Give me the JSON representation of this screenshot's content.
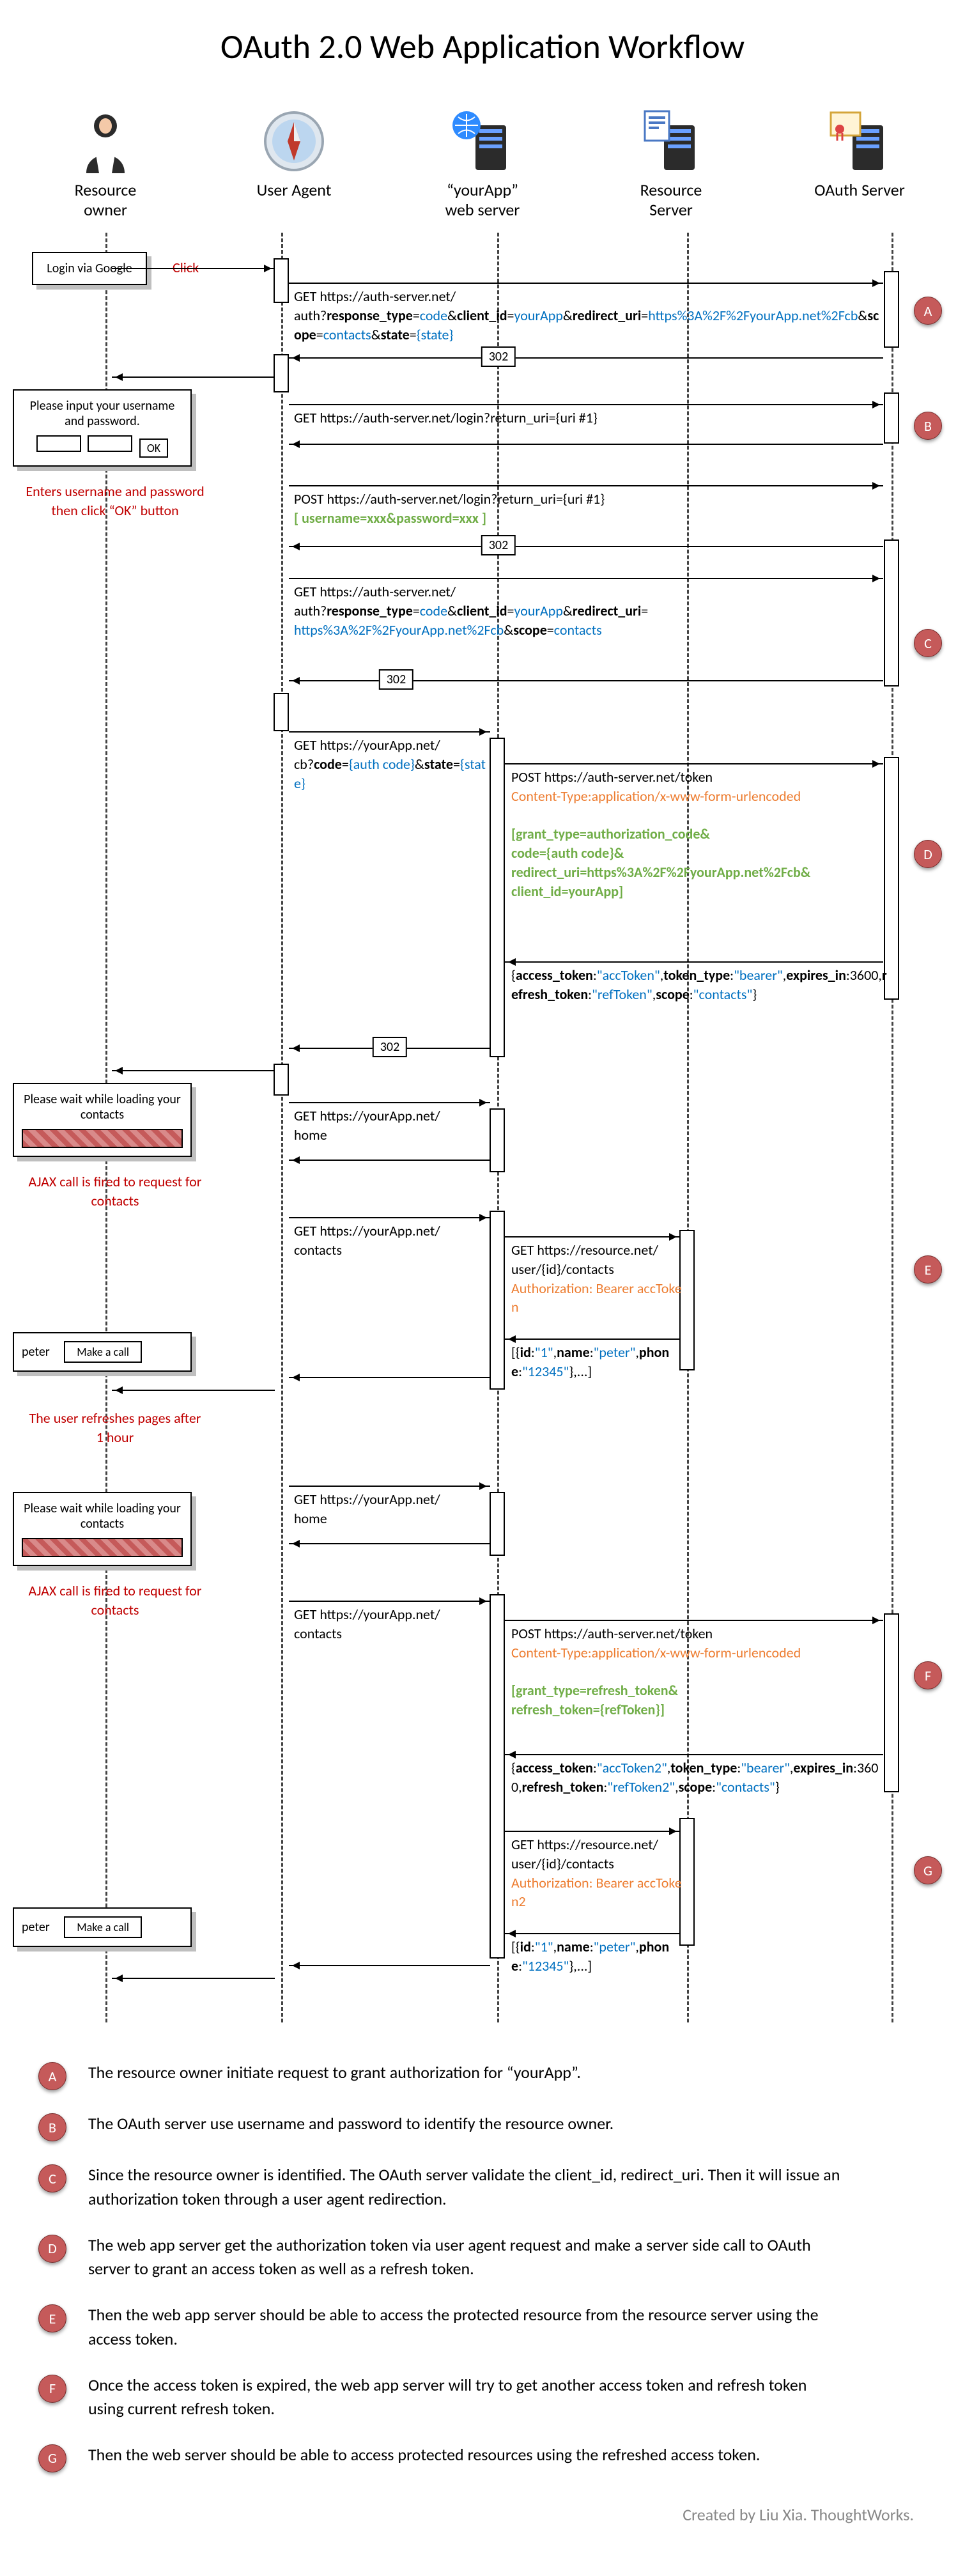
{
  "title": "OAuth 2.0 Web Application Workflow",
  "actors": [
    {
      "id": "resource-owner",
      "label": "Resource owner"
    },
    {
      "id": "user-agent",
      "label": "User Agent"
    },
    {
      "id": "yourapp",
      "label": "“yourApp”\nweb server"
    },
    {
      "id": "resource-server",
      "label": "Resource Server"
    },
    {
      "id": "oauth-server",
      "label": "OAuth Server"
    }
  ],
  "ui": {
    "login_button": "Login via Google",
    "click": "Click",
    "login_prompt": "Please input your username and password.",
    "ok": "OK",
    "loading_contacts": "Please wait while loading your contacts",
    "peter": "peter",
    "make_call": "Make a call"
  },
  "notes": {
    "enter_creds": "Enters username and password then click “OK” button",
    "ajax": "AJAX call is fired to request for contacts",
    "refresh": "The user refreshes pages after 1 hour"
  },
  "msgs": {
    "auth_get": {
      "pre": "GET https://auth-server.net/\nauth?",
      "k1": "response_type",
      "v1": "code",
      "k2": "client_id",
      "v2": "yourApp",
      "k3": "redirect_uri",
      "v3": "https%3A%2F%2FyourApp.net%2Fcb",
      "k4": "scope",
      "v4": "contacts",
      "k5": "state",
      "v5": "{state}"
    },
    "login_get": "GET https://auth-server.net/login?return_uri={uri #1}",
    "login_post_line": "POST https://auth-server.net/login?return_uri={uri #1}",
    "login_post_body_l": "[ ",
    "u_k": "username",
    "u_v": "=xxx",
    "amp": "&",
    "p_k": "password",
    "p_v": "=xxx ",
    "login_post_body_r": "]",
    "auth_get2": {
      "pre": "GET https://auth-server.net/\nauth?",
      "k1": "response_type",
      "v1": "code",
      "k2": "client_id",
      "v2": "yourApp",
      "k3": "redirect_uri",
      "v3": "https%3A%2F%2FyourApp.net%2Fcb",
      "k4": "scope",
      "v4": "contacts"
    },
    "cb_get": {
      "pre": "GET https://yourApp.net/\ncb?",
      "k1": "code",
      "v1": "{auth code}",
      "k2": "state",
      "v2": "{state}"
    },
    "token_post": "POST https://auth-server.net/token",
    "ct": "Content-Type:application/x-www-form-urlencoded",
    "token_body": {
      "l": "[",
      "k1": "grant_type",
      "v1": "authorization_code",
      "k2": "code",
      "v2": "{auth code}",
      "k3": "redirect_uri",
      "v3": "https%3A%2F%2FyourApp.net%2Fcb",
      "k4": "client_id",
      "v4": "yourApp",
      "r": "]"
    },
    "token_resp": {
      "l": "{",
      "k1": "access_token",
      "v1": "\"accToken\"",
      "k2": "token_type",
      "v2": "\"bearer\"",
      "k3": "expires_in",
      "v3": "3600",
      "k4": "refresh_token",
      "v4": "\"refToken\"",
      "k5": "scope",
      "v5": "\"contacts\"",
      "r": "}"
    },
    "home_get": "GET https://yourApp.net/\nhome",
    "contacts_get": "GET https://yourApp.net/\ncontacts",
    "resource_get": "GET https://resource.net/\nuser/{id}/contacts",
    "authz1": "Authorization: Bearer accToken",
    "contacts_resp": {
      "l": "[{",
      "k1": "id",
      "v1": "\"1\"",
      "k2": "name",
      "v2": "\"peter\"",
      "k3": "phone",
      "v3": "\"12345\"",
      "r": "},...]"
    },
    "refresh_body": {
      "l": "[",
      "k1": "grant_type",
      "v1": "refresh_token",
      "k2": "refresh_token",
      "v2": "{refToken}",
      "r": "]"
    },
    "token_resp2": {
      "l": "{",
      "k1": "access_token",
      "v1": "\"accToken2\"",
      "k2": "token_type",
      "v2": "\"bearer\"",
      "k3": "expires_in",
      "v3": "3600",
      "k4": "refresh_token",
      "v4": "\"refToken2\"",
      "k5": "scope",
      "v5": "\"contacts\"",
      "r": "}"
    },
    "authz2": "Authorization: Bearer accToken2",
    "code302": "302"
  },
  "legend": [
    {
      "id": "A",
      "text": "The resource owner initiate request to grant authorization for “yourApp”."
    },
    {
      "id": "B",
      "text": "The OAuth server use username and password to identify the resource owner."
    },
    {
      "id": "C",
      "text": "Since the resource owner is identified. The OAuth server validate the client_id, redirect_uri. Then it will issue an authorization token through a user agent redirection."
    },
    {
      "id": "D",
      "text": "The web app server get the authorization token via user agent request and make a server side call to OAuth server to grant an access token as well as a refresh token."
    },
    {
      "id": "E",
      "text": "Then the web app server should be able to access the protected resource from the resource server using the access token."
    },
    {
      "id": "F",
      "text": "Once the access token is expired, the web app server will try to get another access token and refresh token using current refresh token."
    },
    {
      "id": "G",
      "text": "Then the web server should be able to access protected resources using the refreshed access token."
    }
  ],
  "credit": "Created by Liu Xia. ThoughtWorks."
}
